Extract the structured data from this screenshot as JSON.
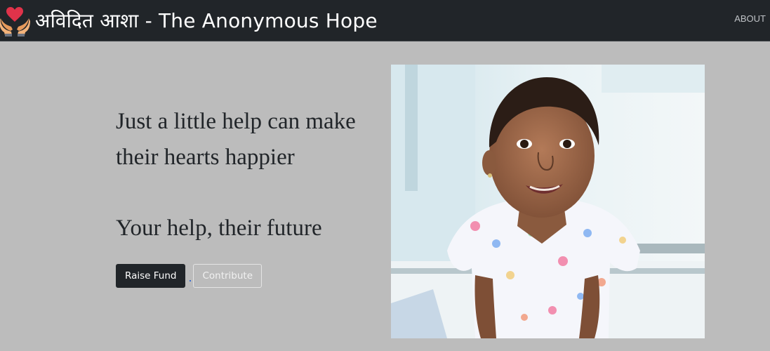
{
  "navbar": {
    "brand_title": "अविदित आशा - The Anonymous Hope",
    "logo_icon": "hands-holding-heart-icon",
    "about_label": "ABOUT"
  },
  "hero": {
    "tagline": "Just a little help can make their hearts happier",
    "subtagline": "Your help, their future",
    "raise_fund_label": "Raise Fund",
    "contribute_label": "Contribute",
    "image_subject": "smiling-child-in-hospital-photo"
  },
  "colors": {
    "navbar_bg": "#212529",
    "page_bg": "#bcbcbc",
    "heart": "#e0334a",
    "button_dark": "#212529"
  }
}
